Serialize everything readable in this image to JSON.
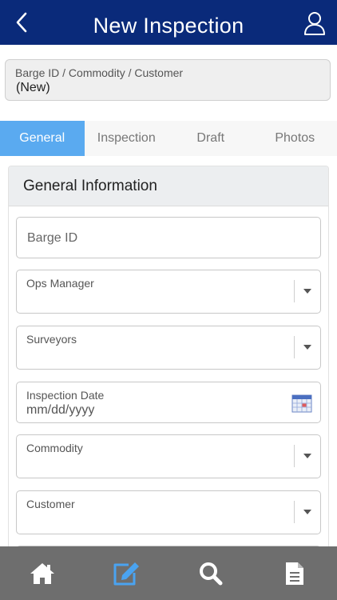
{
  "header": {
    "title": "New Inspection"
  },
  "context": {
    "label": "Barge ID / Commodity / Customer",
    "value": "(New)"
  },
  "tabs": [
    {
      "label": "General",
      "active": true
    },
    {
      "label": "Inspection",
      "active": false
    },
    {
      "label": "Draft",
      "active": false
    },
    {
      "label": "Photos",
      "active": false
    }
  ],
  "card": {
    "title": "General Information"
  },
  "fields": {
    "barge_id": {
      "placeholder": "Barge ID"
    },
    "ops_manager": {
      "label": "Ops Manager",
      "value": ""
    },
    "surveyors": {
      "label": "Surveyors",
      "value": ""
    },
    "inspection_date": {
      "label": "Inspection Date",
      "placeholder": "mm/dd/yyyy"
    },
    "commodity": {
      "label": "Commodity",
      "value": ""
    },
    "customer": {
      "label": "Customer",
      "value": ""
    }
  },
  "bottom_nav": {
    "items": [
      {
        "icon": "home-icon",
        "active": false
      },
      {
        "icon": "edit-icon",
        "active": true
      },
      {
        "icon": "search-icon",
        "active": false
      },
      {
        "icon": "document-icon",
        "active": false
      }
    ]
  },
  "colors": {
    "header_bg": "#0a2a7a",
    "tab_active": "#5aaaf0",
    "bottom_bar": "#6e6e6e",
    "nav_active": "#4aa3f0"
  }
}
